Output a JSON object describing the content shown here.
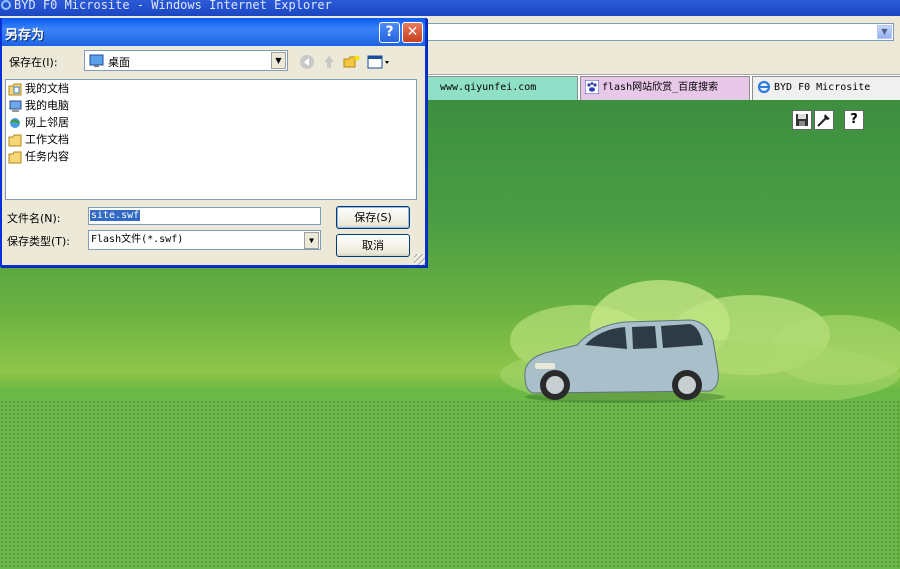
{
  "browser": {
    "window_title": "BYD F0 Microsite - Windows Internet Explorer",
    "tabs": [
      {
        "label": "www.qiyunfei.com"
      },
      {
        "label": "flash网站欣赏_百度搜索"
      },
      {
        "label": "BYD F0 Microsite"
      }
    ]
  },
  "dialog": {
    "title": "另存为",
    "help_label": "?",
    "close_label": "✕",
    "save_in_label": "保存在(I):",
    "save_in_value": "桌面",
    "items": [
      {
        "label": "我的文档",
        "icon": "my-documents-icon"
      },
      {
        "label": "我的电脑",
        "icon": "my-computer-icon"
      },
      {
        "label": "网上邻居",
        "icon": "network-places-icon"
      },
      {
        "label": "工作文档",
        "icon": "folder-icon"
      },
      {
        "label": "任务内容",
        "icon": "folder-icon"
      }
    ],
    "filename_label": "文件名(N):",
    "filename_value": "site.swf",
    "filetype_label": "保存类型(T):",
    "filetype_value": "Flash文件(*.swf)",
    "save_button": "保存(S)",
    "cancel_button": "取消"
  },
  "flash_toolbar": {
    "items": [
      "save-icon",
      "tools-icon",
      "help-icon"
    ],
    "help_label": "?"
  },
  "colors": {
    "title_bar": "#0a5bef",
    "page_green": "#4a9d44",
    "grass": "#6cb84a"
  }
}
